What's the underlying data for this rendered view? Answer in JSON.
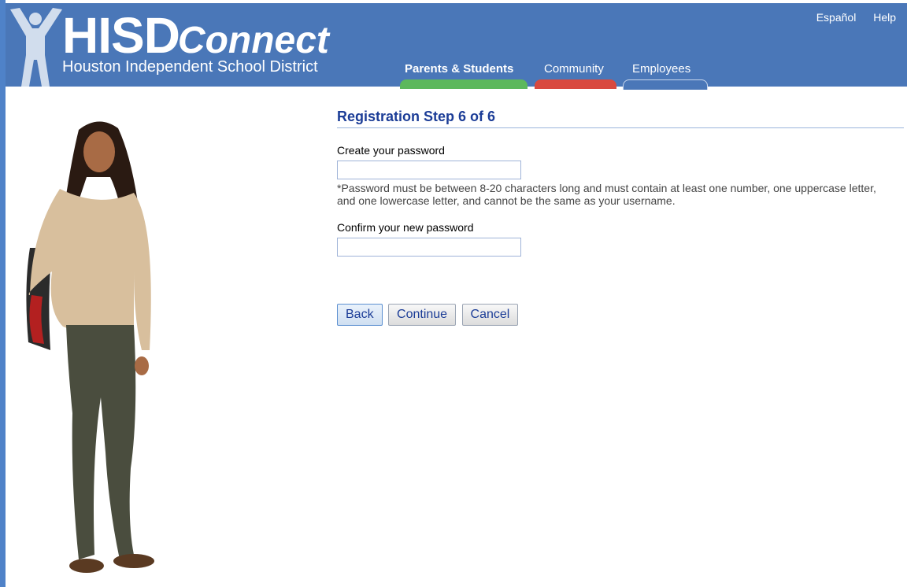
{
  "header": {
    "logo_main": "HISD",
    "logo_accent": "Connect",
    "logo_subtitle": "Houston Independent School District",
    "utility_links": {
      "language": "Español",
      "help": "Help"
    },
    "nav_tabs": [
      {
        "label": "Parents & Students",
        "color": "#5cb85c",
        "active": true
      },
      {
        "label": "Community",
        "color": "#d9493f",
        "active": false
      },
      {
        "label": "Employees",
        "color": "#4a77b8",
        "active": false
      }
    ]
  },
  "form": {
    "title": "Registration Step 6 of 6",
    "password_label": "Create your password",
    "password_value": "",
    "password_hint": "*Password must be between 8-20 characters long and must contain at least one number, one uppercase letter, and one lowercase letter, and cannot be the same as your username.",
    "confirm_label": "Confirm your new password",
    "confirm_value": "",
    "buttons": {
      "back": "Back",
      "continue": "Continue",
      "cancel": "Cancel"
    }
  },
  "colors": {
    "header_bg": "#4a77b8",
    "title_color": "#1c3d97",
    "frame_left": "#4f82c8"
  }
}
